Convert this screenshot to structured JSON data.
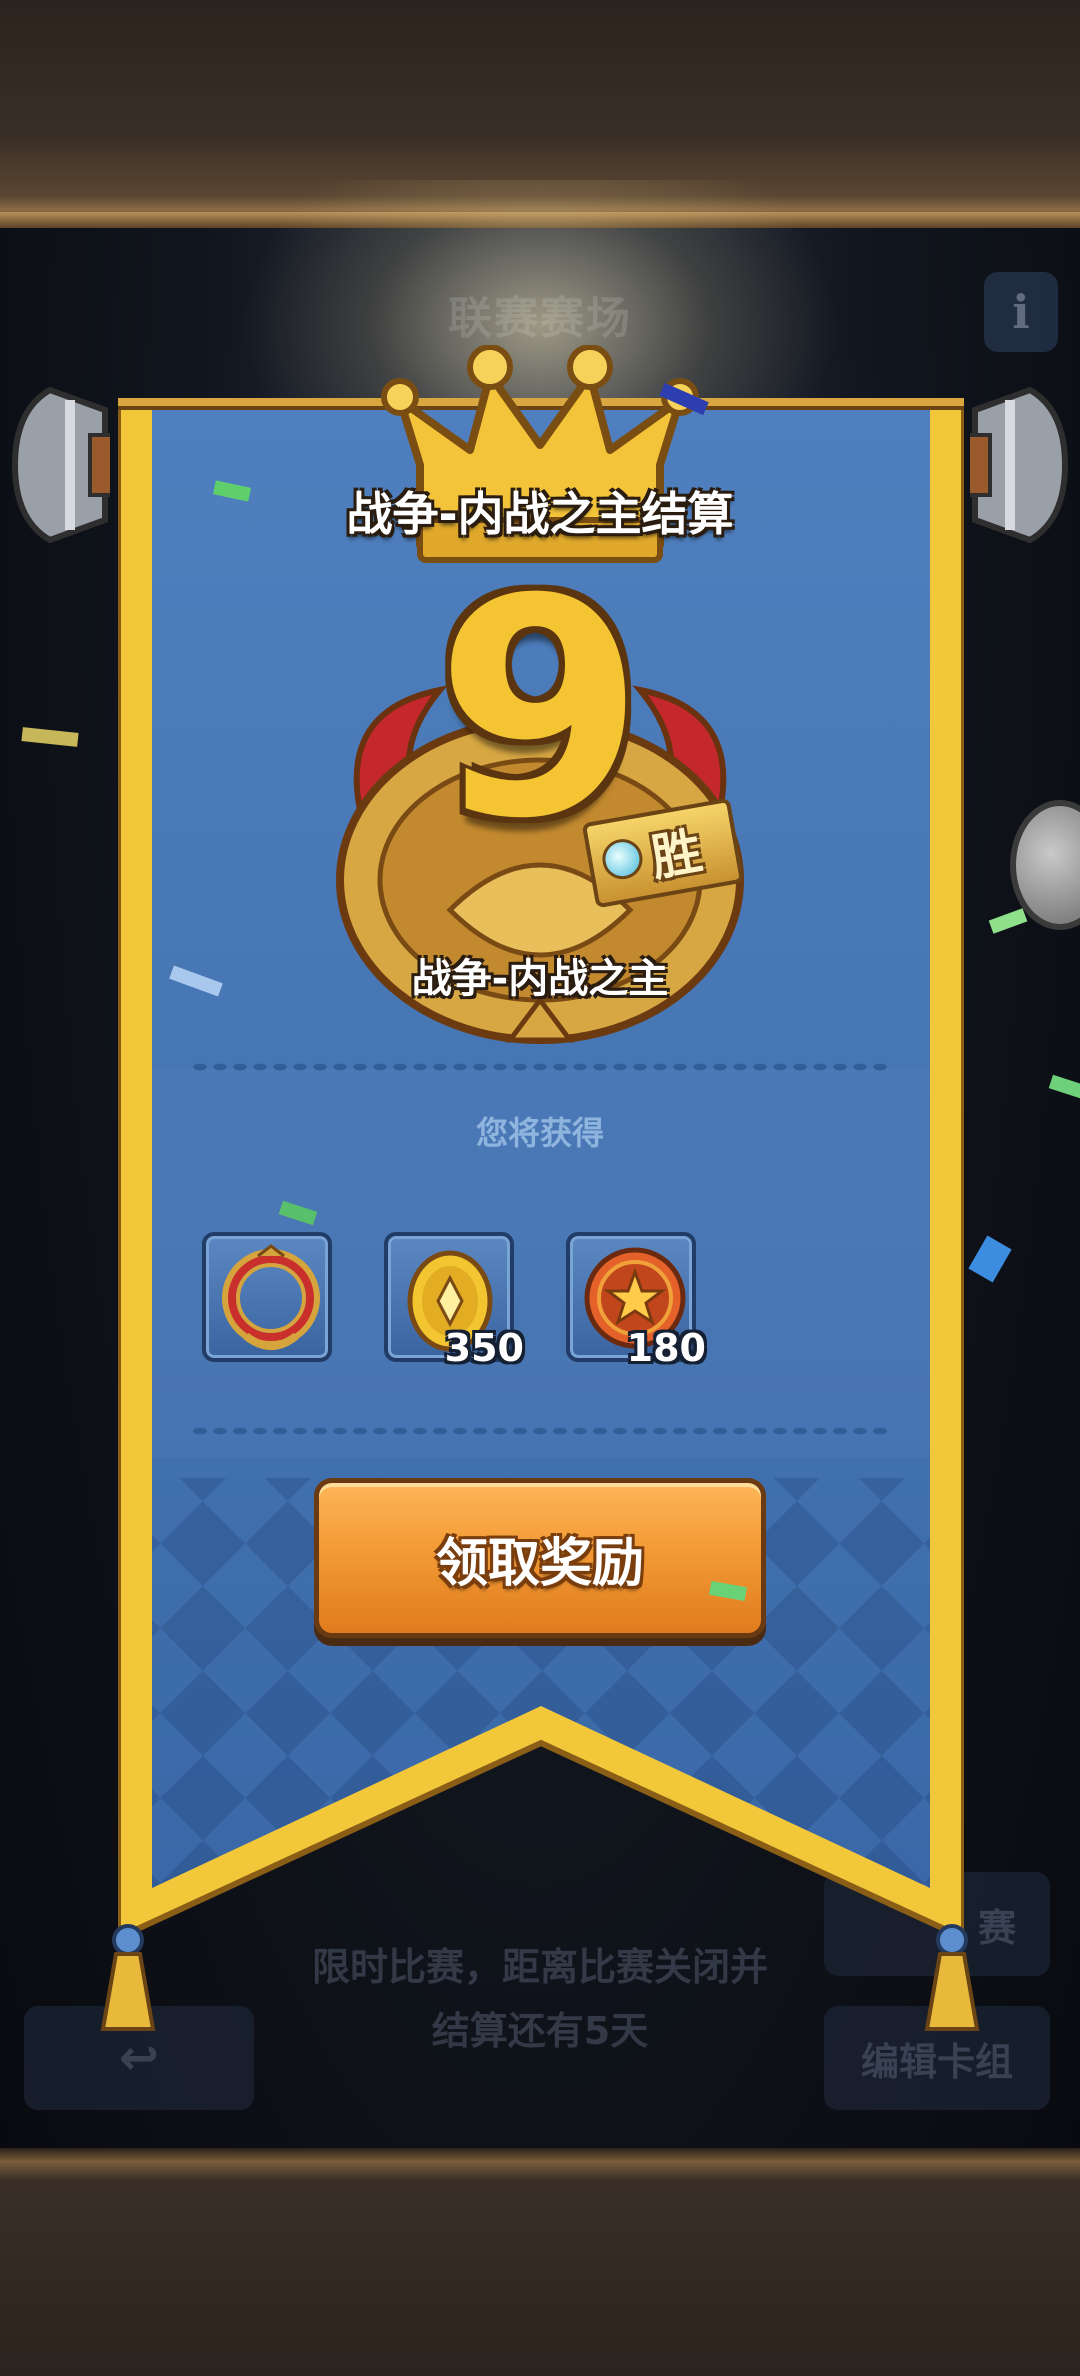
{
  "background": {
    "title": "联赛赛场",
    "info_icon_label": "i",
    "notice_line1": "限时比赛，距离比赛关闭并",
    "notice_line2": "结算还有5天",
    "right_button_top": "赛",
    "right_button_bottom": "编辑卡组"
  },
  "result": {
    "title": "战争-内战之主结算",
    "wins": "9",
    "win_suffix": "胜",
    "medal_name": "战争-内战之主",
    "receive_label": "您将获得"
  },
  "rewards": [
    {
      "icon": "ring-frame-icon",
      "qty": ""
    },
    {
      "icon": "gold-coin-icon",
      "qty": "350"
    },
    {
      "icon": "star-badge-icon",
      "qty": "180"
    }
  ],
  "claim_button": {
    "label": "领取奖励"
  },
  "colors": {
    "banner_blue": "#4a78b5",
    "banner_gold": "#f2c73a",
    "number_gold": "#f5c433",
    "button_orange": "#f29a35"
  }
}
